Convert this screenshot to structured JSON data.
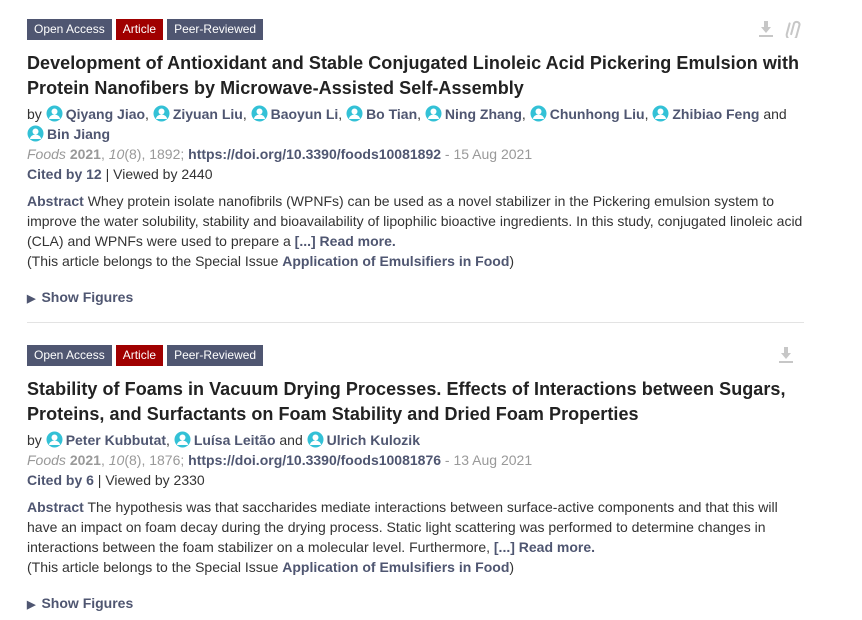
{
  "articles": [
    {
      "badges": [
        "Open Access",
        "Article",
        "Peer-Reviewed"
      ],
      "title": "Development of Antioxidant and Stable Conjugated Linoleic Acid Pickering Emulsion with Protein Nanofibers by Microwave-Assisted Self-Assembly",
      "by": "by",
      "authors": [
        "Qiyang Jiao",
        "Ziyuan Liu",
        "Baoyun Li",
        "Bo Tian",
        "Ning Zhang",
        "Chunhong Liu",
        "Zhibiao Feng",
        "Bin Jiang"
      ],
      "and": "and",
      "journal": "Foods",
      "year": "2021",
      "volume": "10",
      "issue": "(8), 1892;",
      "doi": "https://doi.org/10.3390/foods10081892",
      "date": "- 15 Aug 2021",
      "cited": "Cited by 12",
      "viewed": "| Viewed by 2440",
      "abstract_label": "Abstract",
      "abstract_text": "Whey protein isolate nanofibrils (WPNFs) can be used as a novel stabilizer in the Pickering emulsion system to improve the water solubility, stability and bioavailability of lipophilic bioactive ingredients. In this study, conjugated linoleic acid (CLA) and WPNFs were used to prepare a",
      "read_more": "[...] Read more.",
      "special_prefix": "(This article belongs to the Special Issue",
      "special_issue": "Application of Emulsifiers in Food",
      "special_suffix": ")",
      "show_figures": "Show Figures"
    },
    {
      "badges": [
        "Open Access",
        "Article",
        "Peer-Reviewed"
      ],
      "title": "Stability of Foams in Vacuum Drying Processes. Effects of Interactions between Sugars, Proteins, and Surfactants on Foam Stability and Dried Foam Properties",
      "by": "by",
      "authors": [
        "Peter Kubbutat",
        "Luísa Leitão",
        "Ulrich Kulozik"
      ],
      "and": "and",
      "journal": "Foods",
      "year": "2021",
      "volume": "10",
      "issue": "(8), 1876;",
      "doi": "https://doi.org/10.3390/foods10081876",
      "date": "- 13 Aug 2021",
      "cited": "Cited by 6",
      "viewed": "| Viewed by 2330",
      "abstract_label": "Abstract",
      "abstract_text": "The hypothesis was that saccharides mediate interactions between surface-active components and that this will have an impact on foam decay during the drying process. Static light scattering was performed to determine changes in interactions between the foam stabilizer on a molecular level. Furthermore,",
      "read_more": "[...] Read more.",
      "special_prefix": "(This article belongs to the Special Issue",
      "special_issue": "Application of Emulsifiers in Food",
      "special_suffix": ")",
      "show_figures": "Show Figures"
    }
  ],
  "icons": {
    "download": "download-icon",
    "attach": "paperclip-icon",
    "author": "author-avatar-icon",
    "triangle": "triangle-right-icon"
  },
  "colors": {
    "badge_dark": "#4f5671",
    "badge_red": "#a00000",
    "link": "#4f5671",
    "avatar": "#33c1d6"
  }
}
